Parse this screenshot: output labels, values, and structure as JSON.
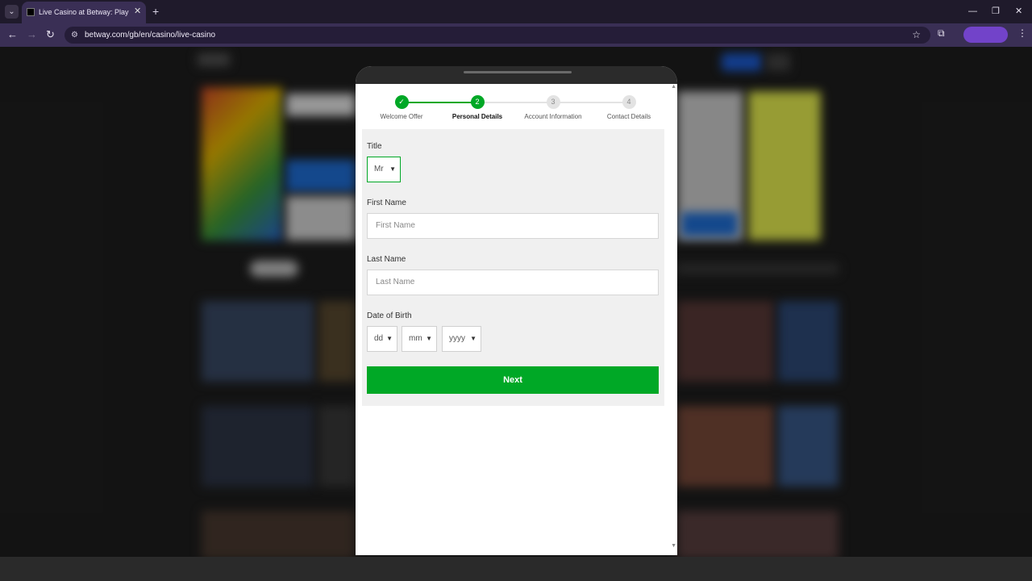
{
  "browser": {
    "tab_title": "Live Casino at Betway: Play Real",
    "tab_close": "✕",
    "new_tab": "+",
    "url": "betway.com/gb/en/casino/live-casino",
    "minimize": "—",
    "maximize": "❐",
    "close": "✕"
  },
  "signup": {
    "steps": [
      {
        "label": "Welcome Offer",
        "marker": "✓",
        "state": "done"
      },
      {
        "label": "Personal Details",
        "marker": "2",
        "state": "active"
      },
      {
        "label": "Account Information",
        "marker": "3",
        "state": "todo"
      },
      {
        "label": "Contact Details",
        "marker": "4",
        "state": "todo"
      }
    ],
    "title_label": "Title",
    "title_value": "Mr",
    "first_name_label": "First Name",
    "first_name_placeholder": "First Name",
    "last_name_label": "Last Name",
    "last_name_placeholder": "Last Name",
    "dob_label": "Date of Birth",
    "dob_day": "dd",
    "dob_month": "mm",
    "dob_year": "yyyy",
    "next_label": "Next"
  },
  "colors": {
    "accent": "#00a826",
    "chrome": "#3a2f55",
    "profile": "#7243c9"
  }
}
